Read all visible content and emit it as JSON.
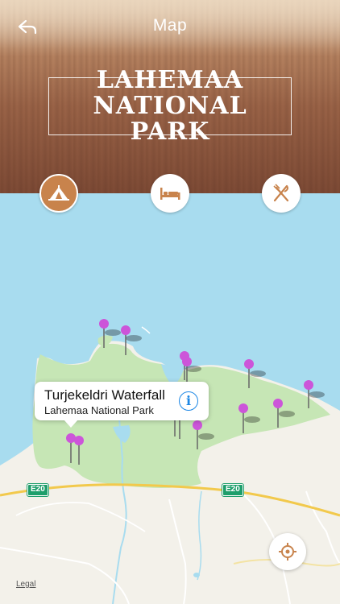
{
  "nav": {
    "title": "Map",
    "back_icon": "back-arrow-icon"
  },
  "park": {
    "title": "LAHEMAA\nNATIONAL PARK"
  },
  "categories": [
    {
      "name": "sightseeing",
      "icon": "tent-icon",
      "active": true
    },
    {
      "name": "hotels",
      "icon": "bed-icon",
      "active": false
    },
    {
      "name": "restaurants",
      "icon": "fork-knife-icon",
      "active": false
    }
  ],
  "callout": {
    "title": "Turjekeldri Waterfall",
    "subtitle": "Lahemaa National Park",
    "info_icon": "info-icon",
    "info_glyph": "i"
  },
  "roads": [
    {
      "label": "E20"
    },
    {
      "label": "E20"
    }
  ],
  "legal": {
    "label": "Legal"
  },
  "colors": {
    "accent": "#c8834c",
    "pin": "#cc55d9",
    "water": "#a8dcef",
    "park": "#c6e6b5",
    "road": "#f2c94c",
    "info": "#1e88e5"
  }
}
